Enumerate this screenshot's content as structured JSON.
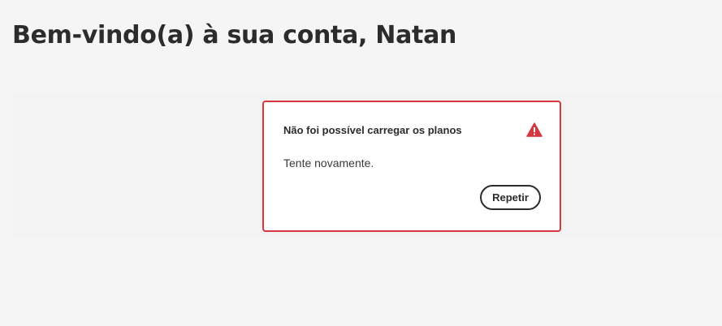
{
  "page": {
    "title": "Bem-vindo(a) à sua conta, Natan"
  },
  "plans_error": {
    "title": "Não foi possível carregar os planos",
    "message": "Tente novamente.",
    "retry_label": "Repetir",
    "icon": "alert-icon",
    "colors": {
      "error": "#d7373f",
      "text": "#2c2c2c",
      "background": "#f5f5f5",
      "card": "#ffffff"
    }
  }
}
